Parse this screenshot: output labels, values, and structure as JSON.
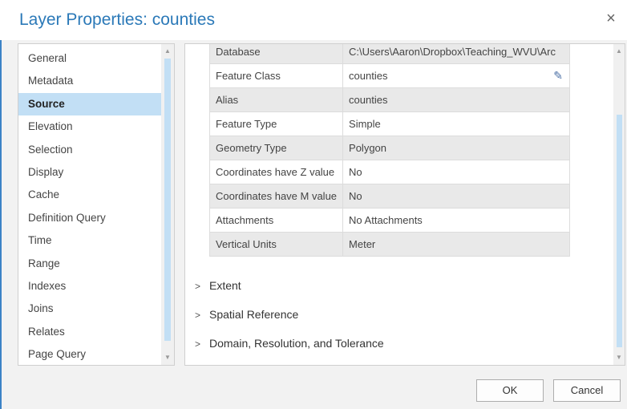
{
  "window": {
    "title": "Layer Properties: counties",
    "close_label": "×"
  },
  "nav": {
    "items": [
      {
        "label": "General"
      },
      {
        "label": "Metadata"
      },
      {
        "label": "Source",
        "active": true
      },
      {
        "label": "Elevation"
      },
      {
        "label": "Selection"
      },
      {
        "label": "Display"
      },
      {
        "label": "Cache"
      },
      {
        "label": "Definition Query"
      },
      {
        "label": "Time"
      },
      {
        "label": "Range"
      },
      {
        "label": "Indexes"
      },
      {
        "label": "Joins"
      },
      {
        "label": "Relates"
      },
      {
        "label": "Page Query"
      }
    ]
  },
  "properties": {
    "rows": [
      {
        "key": "Database",
        "value": "C:\\Users\\Aaron\\Dropbox\\Teaching_WVU\\Arc"
      },
      {
        "key": "Feature Class",
        "value": "counties",
        "editable_icon": "pencil-icon"
      },
      {
        "key": "Alias",
        "value": "counties"
      },
      {
        "key": "Feature Type",
        "value": "Simple"
      },
      {
        "key": "Geometry Type",
        "value": "Polygon"
      },
      {
        "key": "Coordinates have Z value",
        "value": "No"
      },
      {
        "key": "Coordinates have M value",
        "value": "No"
      },
      {
        "key": "Attachments",
        "value": "No Attachments"
      },
      {
        "key": "Vertical Units",
        "value": "Meter"
      }
    ]
  },
  "sections": [
    {
      "label": "Extent",
      "expanded": false
    },
    {
      "label": "Spatial Reference",
      "expanded": false
    },
    {
      "label": "Domain, Resolution, and Tolerance",
      "expanded": false
    }
  ],
  "buttons": {
    "ok": "OK",
    "cancel": "Cancel"
  },
  "colors": {
    "accent": "#2b79b8",
    "selection": "#c2dff5"
  }
}
